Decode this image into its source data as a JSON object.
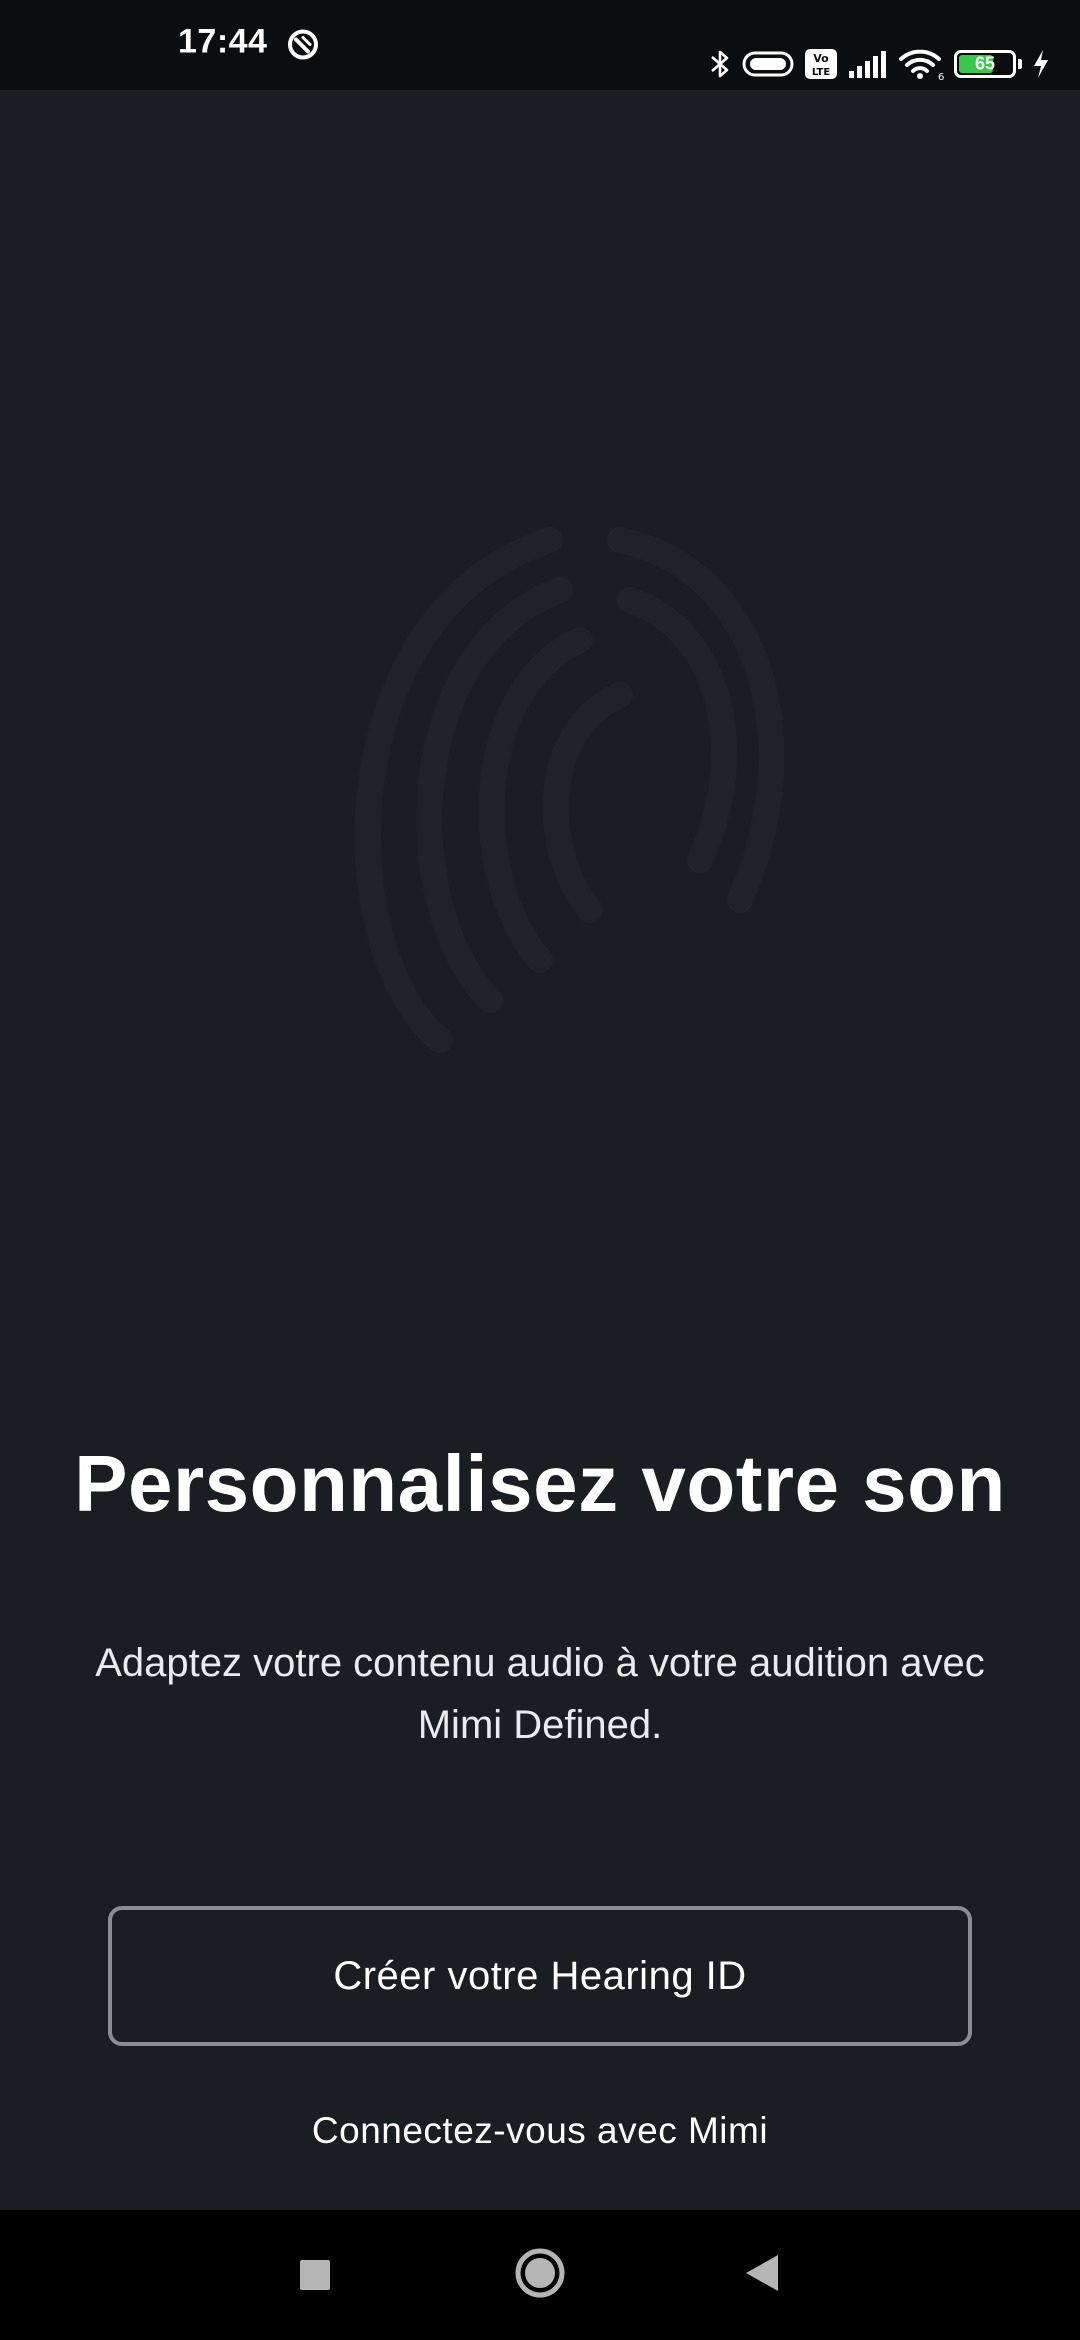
{
  "status_bar": {
    "time": "17:44",
    "battery_level": "65",
    "battery_fraction": 0.65,
    "icons": [
      "bluetooth-icon",
      "vpn-pill-icon",
      "volte-icon",
      "cellular-signal-icon",
      "wifi-icon",
      "battery-icon",
      "charging-icon"
    ]
  },
  "onboarding": {
    "title": "Personnalisez votre son",
    "subtitle": "Adaptez votre contenu audio à votre audition avec Mimi Defined.",
    "primary_button_label": "Créer votre Hearing ID",
    "secondary_link_label": "Connectez-vous avec Mimi"
  },
  "navigation": {
    "buttons": [
      "recents-button",
      "home-button",
      "back-button"
    ]
  },
  "colors": {
    "background": "#1a1d21",
    "status_bar": "#0c0d0f",
    "nav_bar": "#000000",
    "button_border": "#8a8d91",
    "battery_fill": "#37c94a"
  }
}
